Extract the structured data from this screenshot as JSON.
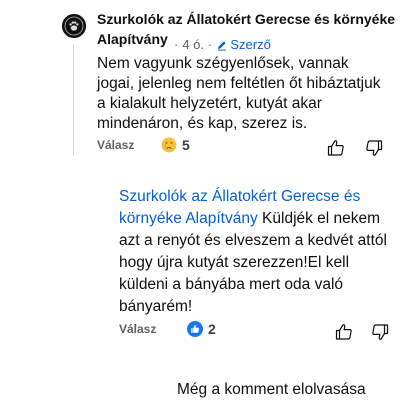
{
  "comment1": {
    "author": "Szurkolók az Állatokért Gerecse és környéke Alapítvány",
    "time": "4 ó.",
    "dot": "·",
    "author_badge": "Szerző",
    "text": "Nem vagyunk szégyenlősek, vannak jogai, jelenleg nem feltétlen őt hibáztatjuk a kialakult helyzetért, kutyát akar mindenáron, és kap, szerez is.",
    "reply_label": "Válasz",
    "reaction_emoji": "crying-face-icon",
    "reaction_count": "5"
  },
  "comment2": {
    "mention": "Szurkolók az Állatokért Gerecse és környéke Alapítvány",
    "text": " Küldjék el nekem azt a renyót és elveszem a kedvét attól hogy újra kutyát szerezzen!El kell küldeni a bányába mert oda való bányarém!",
    "reply_label": "Válasz",
    "reaction_emoji": "like-icon",
    "reaction_count": "2"
  },
  "comment3": {
    "text": "Még a komment elolvasása"
  },
  "colors": {
    "link": "#065fd4",
    "muted": "#606060",
    "text": "#0f0f0f"
  }
}
